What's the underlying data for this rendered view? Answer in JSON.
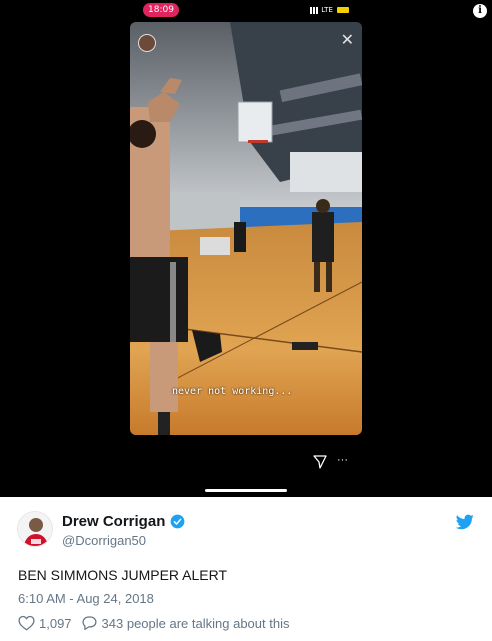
{
  "story": {
    "status_time": "18:09",
    "status_network": "LTE",
    "caption": "never not working..."
  },
  "tweet": {
    "author_name": "Drew Corrigan",
    "author_handle": "@Dcorrigan50",
    "text": "BEN SIMMONS JUMPER ALERT",
    "timestamp": "6:10 AM - Aug 24, 2018",
    "like_count": "1,097",
    "conversation_text": "343 people are talking about this"
  },
  "icons": {
    "info": "info-icon",
    "verified": "verified-badge-icon",
    "twitter": "twitter-bird-icon",
    "like": "heart-icon",
    "reply": "speech-bubble-icon",
    "send": "send-icon",
    "more": "more-icon",
    "close": "close-icon"
  },
  "colors": {
    "twitter_blue": "#1da1f2",
    "text_primary": "#14171a",
    "text_secondary": "#657786",
    "time_pill": "#e0245e"
  }
}
